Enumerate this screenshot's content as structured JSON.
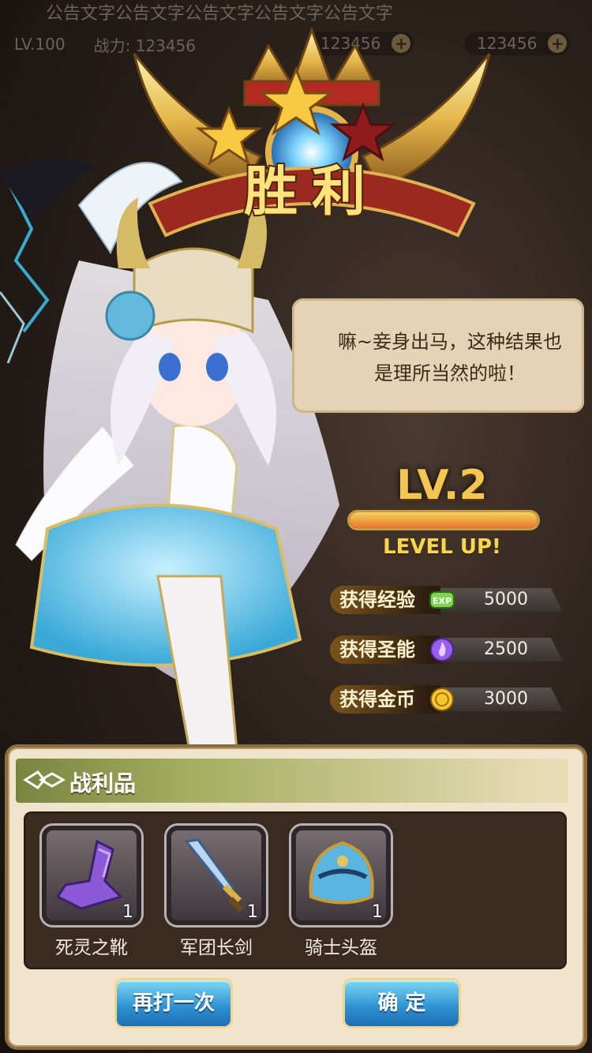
{
  "notice": {
    "text": "公告文字公告文字公告文字公告文字公告文字"
  },
  "topbar": {
    "level": "LV.100",
    "power": "战力: 123456",
    "res1": "123456",
    "res2": "123456",
    "plus": "+"
  },
  "title": {
    "main": "胜利"
  },
  "bubble": {
    "line1": "嘛~妾身出马，这种结果也",
    "line2": "是理所当然的啦！"
  },
  "level": {
    "title": "LV.2",
    "status": "LEVEL UP!",
    "progress": 1.0
  },
  "rewards": [
    {
      "label": "获得经验",
      "value": "5000",
      "icon": "exp-icon"
    },
    {
      "label": "获得圣能",
      "value": "2500",
      "icon": "purple-flame-icon"
    },
    {
      "label": "获得金币",
      "value": "3000",
      "icon": "gold-coin-icon"
    }
  ],
  "loot": {
    "title": "战利品",
    "items": [
      {
        "name": "死灵之靴",
        "count": "1",
        "icon": "boot-icon"
      },
      {
        "name": "军团长剑",
        "count": "1",
        "icon": "sword-icon"
      },
      {
        "name": "骑士头盔",
        "count": "1",
        "icon": "helmet-icon"
      }
    ]
  },
  "buttons": {
    "retry": "再打一次",
    "confirm": "确 定"
  },
  "colors": {
    "gold": "#f2c650",
    "panel": "#f0e4cc",
    "button": "#2c8fd1",
    "loot_bg": "#3a2a20"
  }
}
